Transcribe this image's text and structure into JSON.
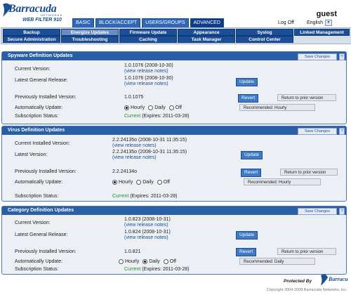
{
  "brand": {
    "name": "Barracuda",
    "sub": "NETWORKS",
    "product": "WEB FILTER 910",
    "color": "#1b4f93"
  },
  "tabs": [
    {
      "label": "BASIC",
      "active": false
    },
    {
      "label": "BLOCK/ACCEPT",
      "active": false
    },
    {
      "label": "USERS/GROUPS",
      "active": false
    },
    {
      "label": "ADVANCED",
      "active": true
    }
  ],
  "header": {
    "user": "guest",
    "logoff": "Log Off",
    "language": "English"
  },
  "subnav": {
    "row1": [
      "Backup",
      "Energize Updates",
      "Firmware Update",
      "Appearance",
      "Syslog",
      "Linked Management"
    ],
    "row2": [
      "Secure Administration",
      "Troubleshooting",
      "Caching",
      "Task Manager",
      "Control Center"
    ],
    "active": "Energize Updates"
  },
  "common": {
    "save": "Save Changes",
    "help": "?",
    "update": "Update",
    "revert": "Revert",
    "return_prior": "Return to prior version",
    "release_notes": "(view release notes)",
    "opt_hourly": "Hourly",
    "opt_daily": "Daily",
    "opt_off": "Off",
    "subscription_label": "Subscription Status:",
    "auto_label": "Automatically Update:"
  },
  "spyware": {
    "title": "Spyware Definition Updates",
    "current_label": "Current Version:",
    "current_value": "1.0.1076 (2008-10-30)",
    "latest_label": "Latest General Release:",
    "latest_value": "1.0.1076 (2008-10-30)",
    "previous_label": "Previously Installed Version:",
    "previous_value": "1.0.1075",
    "auto_selected": "Hourly",
    "recommended": "Recommended: Hourly",
    "status": "Current",
    "expires": "(Expires: 2011-03-28)"
  },
  "virus": {
    "title": "Virus Definition Updates",
    "current_label": "Current Installed Version:",
    "current_value": "2.2.24135o (2008-10-31 11:35:15)",
    "latest_label": "Latest Version:",
    "latest_value": "2.2.24135o (2008-10-31 11:35:15)",
    "previous_label": "Previously Installed Version:",
    "previous_value": "2.2.24134o",
    "auto_selected": "Hourly",
    "recommended": "Recommended: Hourly",
    "status": "Current",
    "expires": "(Expires: 2011-03-28)"
  },
  "category": {
    "title": "Category Definition Updates",
    "current_label": "Current Version:",
    "current_value": "1.0.823 (2008-10-31)",
    "latest_label": "Latest General Release:",
    "latest_value": "1.0.824 (2008-10-31)",
    "previous_label": "Previously Installed Version:",
    "previous_value": "1.0.821",
    "auto_selected": "Daily",
    "recommended": "Recommended: Daily",
    "status": "Current",
    "expires": "(Expires: 2011-03-28)"
  },
  "footer": {
    "protected": "Protected By",
    "copyright": "Copyright 2004-2008 Barracuda Networks, Inc."
  }
}
